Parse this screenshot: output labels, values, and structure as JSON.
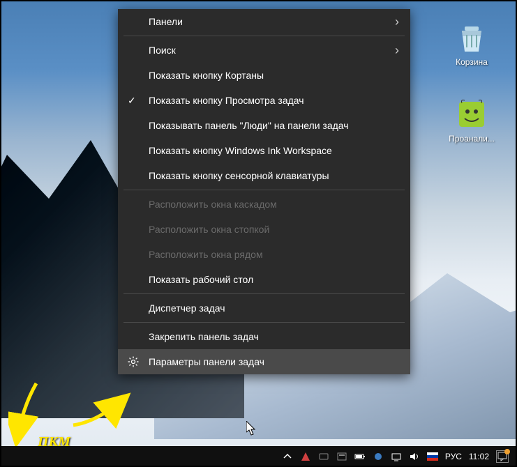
{
  "desktop": {
    "icons": [
      {
        "name": "recycle-bin",
        "label": "Корзина"
      },
      {
        "name": "notepad-plus",
        "label": "Проанали..."
      }
    ]
  },
  "menu": {
    "items": [
      {
        "label": "Панели",
        "arrow": true,
        "section": 0
      },
      {
        "label": "Поиск",
        "arrow": true,
        "section": 1
      },
      {
        "label": "Показать кнопку Кортаны",
        "section": 1
      },
      {
        "label": "Показать кнопку Просмотра задач",
        "checked": true,
        "section": 1
      },
      {
        "label": "Показывать панель \"Люди\" на панели задач",
        "section": 1
      },
      {
        "label": "Показать кнопку Windows Ink Workspace",
        "section": 1
      },
      {
        "label": "Показать кнопку сенсорной клавиатуры",
        "section": 1
      },
      {
        "label": "Расположить окна каскадом",
        "disabled": true,
        "section": 2
      },
      {
        "label": "Расположить окна стопкой",
        "disabled": true,
        "section": 2
      },
      {
        "label": "Расположить окна рядом",
        "disabled": true,
        "section": 2
      },
      {
        "label": "Показать рабочий стол",
        "section": 2
      },
      {
        "label": "Диспетчер задач",
        "section": 3
      },
      {
        "label": "Закрепить панель задач",
        "section": 4
      },
      {
        "label": "Параметры панели задач",
        "icon": "gear",
        "hover": true,
        "section": 4
      }
    ]
  },
  "annotation": {
    "label": "ПКМ"
  },
  "taskbar": {
    "tray": {
      "lang": "РУС",
      "clock": "11:02"
    }
  }
}
